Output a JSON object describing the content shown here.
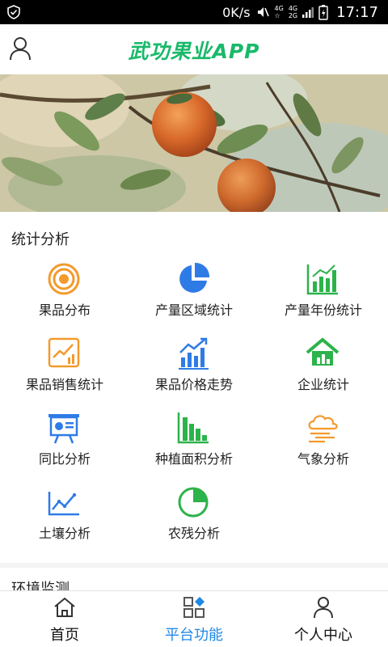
{
  "status_bar": {
    "network_speed": "0K/s",
    "sim1": "4G",
    "sim1_sub": "☆",
    "sim2": "4G",
    "sim2_sub": "2G",
    "time": "17:17"
  },
  "header": {
    "title": "武功果业APP",
    "title_color": "#19b96a"
  },
  "section_stats": {
    "title": "统计分析",
    "items": [
      {
        "label": "果品分布",
        "icon": "target-icon"
      },
      {
        "label": "产量区域统计",
        "icon": "pie-chart-icon"
      },
      {
        "label": "产量年份统计",
        "icon": "bar-chart-icon"
      },
      {
        "label": "果品销售统计",
        "icon": "sales-trend-icon"
      },
      {
        "label": "果品价格走势",
        "icon": "price-trend-icon"
      },
      {
        "label": "企业统计",
        "icon": "house-chart-icon"
      },
      {
        "label": "同比分析",
        "icon": "presentation-icon"
      },
      {
        "label": "种植面积分析",
        "icon": "area-bars-icon"
      },
      {
        "label": "气象分析",
        "icon": "cloud-wind-icon"
      },
      {
        "label": "土壤分析",
        "icon": "line-chart-icon"
      },
      {
        "label": "农残分析",
        "icon": "pie-slice-icon"
      }
    ]
  },
  "section_env": {
    "title": "环境监测"
  },
  "bottom_nav": {
    "items": [
      {
        "label": "首页",
        "icon": "home-icon",
        "active": false
      },
      {
        "label": "平台功能",
        "icon": "grid-icon",
        "active": true
      },
      {
        "label": "个人中心",
        "icon": "user-icon",
        "active": false
      }
    ],
    "active_color": "#1e88e5"
  }
}
